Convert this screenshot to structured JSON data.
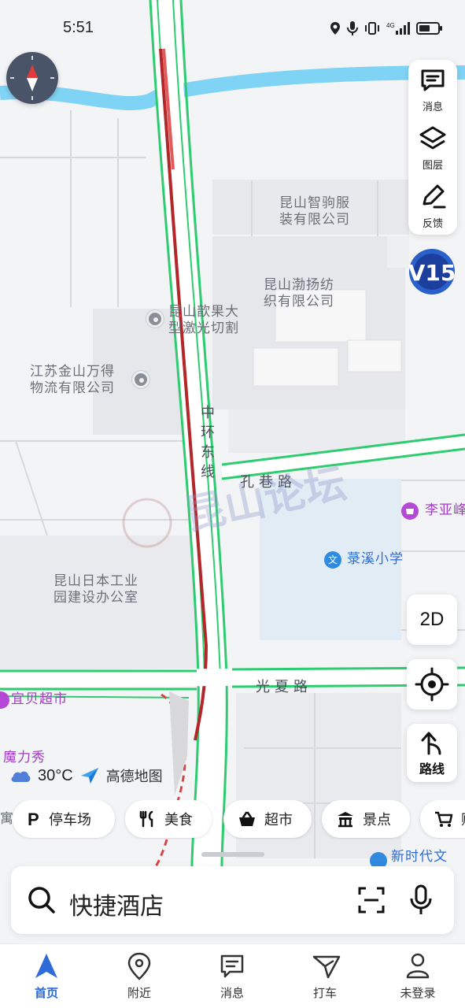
{
  "status_bar": {
    "time": "5:51",
    "battery_level": 0.6
  },
  "map": {
    "labels": {
      "company1": "昆山智驹服\n装有限公司",
      "company2": "昆山渤扬纺\n织有限公司",
      "poi_laser": "昆山歆果大\n型激光切割",
      "poi_logistics": "江苏金山万得\n物流有限公司",
      "road_zhonghuan": "中\n环\n东\n线",
      "road_kongxiang": "孔巷路",
      "road_guangxia": "光夏路",
      "poi_liya": "李亚峰",
      "school": "菉溪小学",
      "office": "昆山日本工业\n园建设办公室",
      "poi_yibei": "宜贝超市",
      "poi_moli": "魔力秀",
      "poi_xinshidai": "新时代文",
      "poi_yu": "寓",
      "watermark": "昆山论坛"
    }
  },
  "tools": {
    "messages": "消息",
    "layers": "图层",
    "feedback": "反馈"
  },
  "controls": {
    "view_mode": "2D",
    "route": "路线"
  },
  "weather": {
    "temperature": "30°C",
    "brand": "高德地图",
    "icon": "cloud-icon"
  },
  "chips": [
    {
      "label": "停车场",
      "icon": "parking-icon"
    },
    {
      "label": "美食",
      "icon": "food-icon"
    },
    {
      "label": "超市",
      "icon": "basket-icon"
    },
    {
      "label": "景点",
      "icon": "temple-icon"
    },
    {
      "label": "购",
      "icon": "cart-icon"
    }
  ],
  "search": {
    "text": "快捷酒店"
  },
  "nav": [
    {
      "label": "首页",
      "active": true
    },
    {
      "label": "附近",
      "active": false
    },
    {
      "label": "消息",
      "active": false
    },
    {
      "label": "打车",
      "active": false
    },
    {
      "label": "未登录",
      "active": false
    }
  ],
  "colors": {
    "accent": "#2f6bd8",
    "road_green": "#2ecc71",
    "traffic_red": "#b3262a",
    "river": "#7fd3f5",
    "poi_purple": "#a03fc2"
  }
}
